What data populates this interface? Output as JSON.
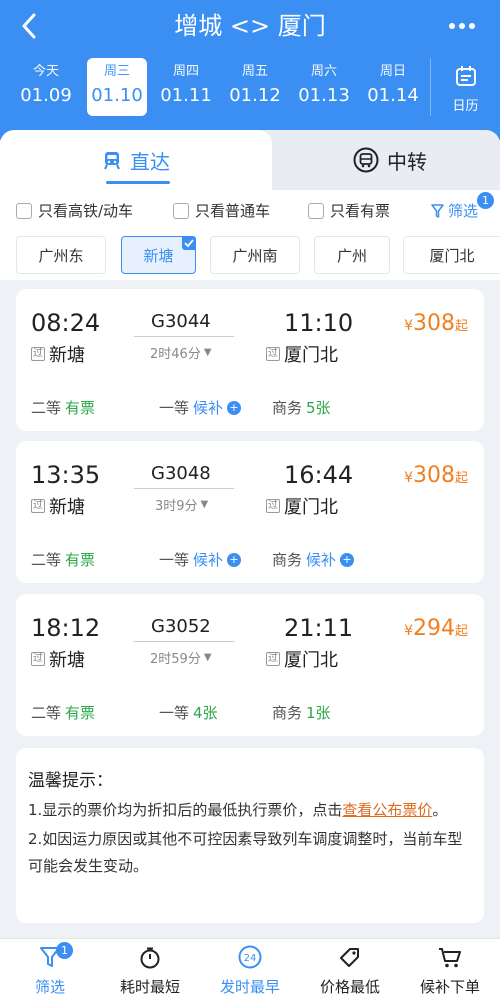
{
  "header": {
    "title": "增城 <> 厦门"
  },
  "dates": [
    {
      "weekday": "今天",
      "date": "01.09",
      "selected": false
    },
    {
      "weekday": "周三",
      "date": "01.10",
      "selected": true
    },
    {
      "weekday": "周四",
      "date": "01.11",
      "selected": false
    },
    {
      "weekday": "周五",
      "date": "01.12",
      "selected": false
    },
    {
      "weekday": "周六",
      "date": "01.13",
      "selected": false
    },
    {
      "weekday": "周日",
      "date": "01.14",
      "selected": false
    }
  ],
  "calendar_label": "日历",
  "tabs": {
    "direct": "直达",
    "transfer": "中转"
  },
  "filters": {
    "high_speed": "只看高铁/动车",
    "normal": "只看普通车",
    "available": "只看有票",
    "filter_label": "筛选",
    "filter_count": "1"
  },
  "stations": [
    "广州东",
    "新塘",
    "广州南",
    "广州",
    "厦门北"
  ],
  "selected_station": "新塘",
  "pass_tag": "过",
  "price_prefix": "¥",
  "price_suffix": "起",
  "trains": [
    {
      "dep_time": "08:24",
      "arr_time": "11:10",
      "train_no": "G3044",
      "duration": "2时46分",
      "dep_station": "新塘",
      "arr_station": "厦门北",
      "price": "308",
      "seats": [
        {
          "class": "二等",
          "status": "有票",
          "type": "available"
        },
        {
          "class": "一等",
          "status": "候补",
          "type": "waitlist"
        },
        {
          "class": "商务",
          "status": "5张",
          "type": "available"
        }
      ]
    },
    {
      "dep_time": "13:35",
      "arr_time": "16:44",
      "train_no": "G3048",
      "duration": "3时9分",
      "dep_station": "新塘",
      "arr_station": "厦门北",
      "price": "308",
      "seats": [
        {
          "class": "二等",
          "status": "有票",
          "type": "available"
        },
        {
          "class": "一等",
          "status": "候补",
          "type": "waitlist"
        },
        {
          "class": "商务",
          "status": "候补",
          "type": "waitlist"
        }
      ]
    },
    {
      "dep_time": "18:12",
      "arr_time": "21:11",
      "train_no": "G3052",
      "duration": "2时59分",
      "dep_station": "新塘",
      "arr_station": "厦门北",
      "price": "294",
      "seats": [
        {
          "class": "二等",
          "status": "有票",
          "type": "available"
        },
        {
          "class": "一等",
          "status": "4张",
          "type": "available"
        },
        {
          "class": "商务",
          "status": "1张",
          "type": "available"
        }
      ]
    }
  ],
  "tips": {
    "title": "温馨提示：",
    "line1_pre": "1.显示的票价均为折扣后的最低执行票价，点击",
    "line1_link": "查看公布票价",
    "line1_post": "。",
    "line2": "2.如因运力原因或其他不可控因素导致列车调度调整时，当前车型可能会发生变动。"
  },
  "bottom_bar": [
    {
      "label": "筛选",
      "badge": "1"
    },
    {
      "label": "耗时最短"
    },
    {
      "label": "发时最早",
      "icon_text": "24",
      "active": true
    },
    {
      "label": "价格最低"
    },
    {
      "label": "候补下单"
    }
  ],
  "colors": {
    "primary": "#3b8ff3",
    "price": "#f08020",
    "available": "#2aaa4a"
  }
}
